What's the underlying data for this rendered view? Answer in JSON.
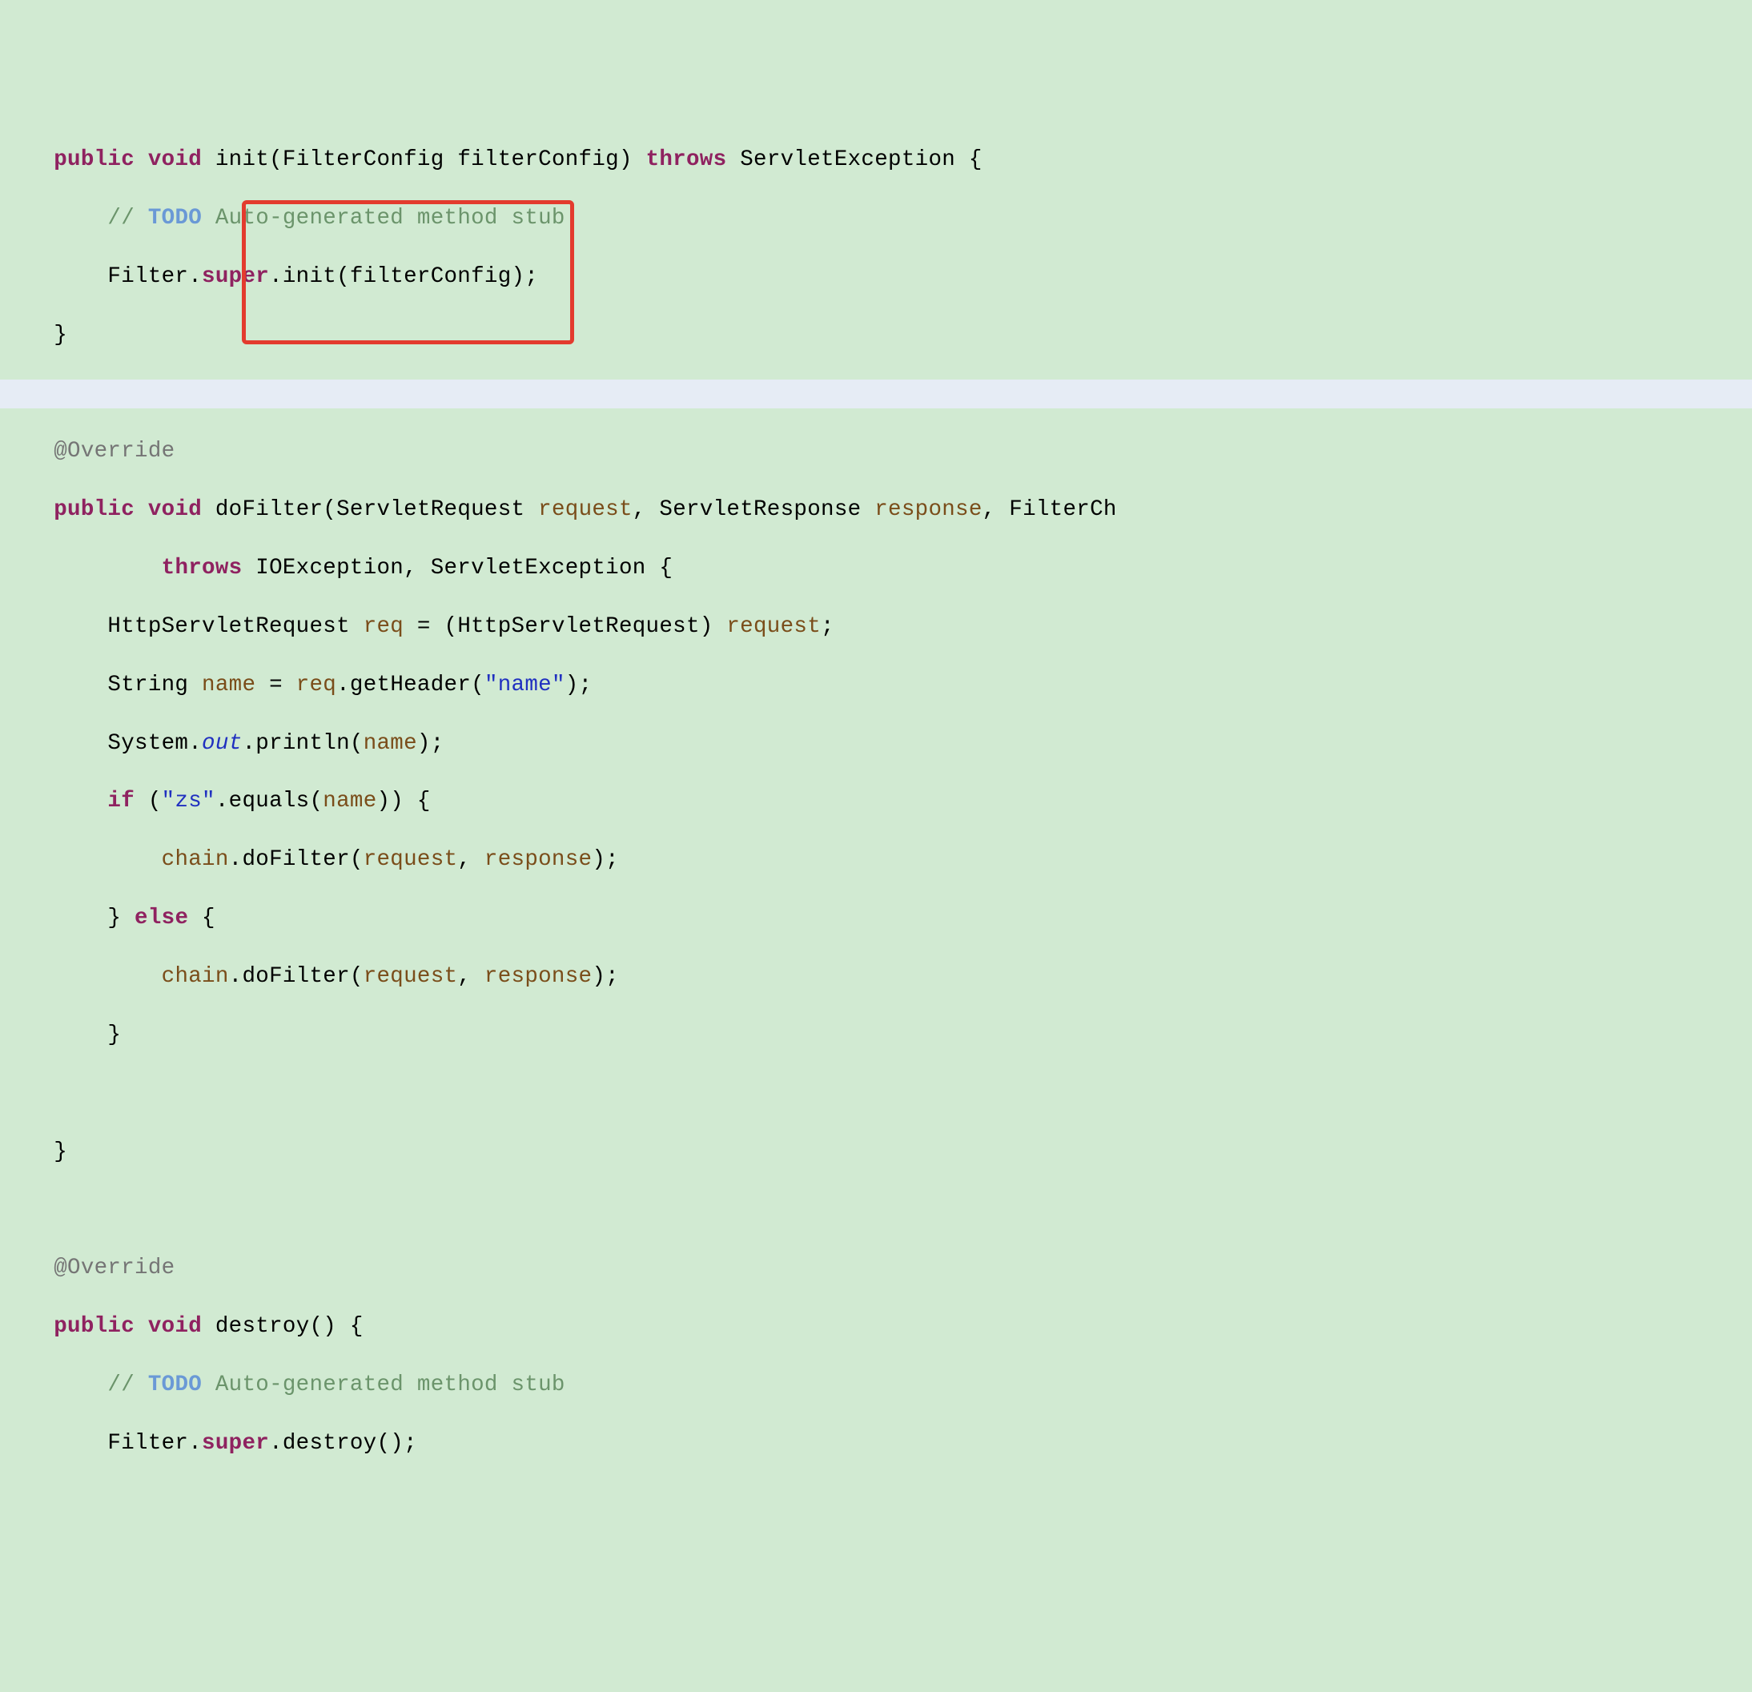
{
  "code": {
    "l1_kw_public": "public",
    "l1_kw_void": "void",
    "l1_method": " init(FilterConfig filterConfig) ",
    "l1_kw_throws": "throws",
    "l1_tail": " ServletException {",
    "l2_pad": "        ",
    "l2_slashes": "// ",
    "l2_todo": "TODO",
    "l2_rest": " Auto-generated method stub",
    "l3_pad": "        Filter.",
    "l3_kw_super": "super",
    "l3_tail": ".init(filterConfig);",
    "l4": "    }",
    "l6_pad": "    ",
    "l6_anno": "@Override",
    "l7_pad": "    ",
    "l7_kw_public": "public",
    "l7_sp1": " ",
    "l7_kw_void": "void",
    "l7_mid1": " doFilter(ServletRequest ",
    "l7_var_request": "request",
    "l7_mid2": ", ServletResponse ",
    "l7_var_response": "response",
    "l7_mid3": ", FilterCh",
    "l8_pad": "            ",
    "l8_kw_throws": "throws",
    "l8_tail": " IOException, ServletException {",
    "l9_pad": "        HttpServletRequest ",
    "l9_var_req": "req",
    "l9_mid": " = (HttpServletRequest) ",
    "l9_var_request": "request",
    "l9_tail": ";",
    "l10_pad": "        String ",
    "l10_var_name": "name",
    "l10_mid": " = ",
    "l10_var_req": "req",
    "l10_mid2": ".getHeader(",
    "l10_str": "\"name\"",
    "l10_tail": ");",
    "l11_pad": "        System.",
    "l11_out": "out",
    "l11_mid": ".println(",
    "l11_var_name": "name",
    "l11_tail": ");",
    "l12_pad": "        ",
    "l12_kw_if": "if",
    "l12_mid1": " (",
    "l12_str": "\"zs\"",
    "l12_mid2": ".equals(",
    "l12_var_name": "name",
    "l12_tail": ")) {",
    "l13_pad": "            ",
    "l13_var_chain": "chain",
    "l13_mid1": ".doFilter(",
    "l13_var_request": "request",
    "l13_mid2": ", ",
    "l13_var_response": "response",
    "l13_tail": ");",
    "l14_pad": "        } ",
    "l14_kw_else": "else",
    "l14_tail": " {",
    "l15_pad": "            ",
    "l15_var_chain": "chain",
    "l15_mid1": ".doFilter(",
    "l15_var_request": "request",
    "l15_mid2": ", ",
    "l15_var_response": "response",
    "l15_tail": ");",
    "l16": "        }",
    "l17": " ",
    "l18": "    }",
    "l19": " ",
    "l20_pad": "    ",
    "l20_anno": "@Override",
    "l21_pad": "    ",
    "l21_kw_public": "public",
    "l21_sp": " ",
    "l21_kw_void": "void",
    "l21_tail": " destroy() {",
    "l22_pad": "        ",
    "l22_slashes": "// ",
    "l22_todo": "TODO",
    "l22_rest": " Auto-generated method stub",
    "l23_pad": "        Filter.",
    "l23_kw_super": "super",
    "l23_tail": ".destroy();"
  },
  "highlight": {
    "top": "250",
    "left": "302",
    "width": "415",
    "height": "180"
  }
}
